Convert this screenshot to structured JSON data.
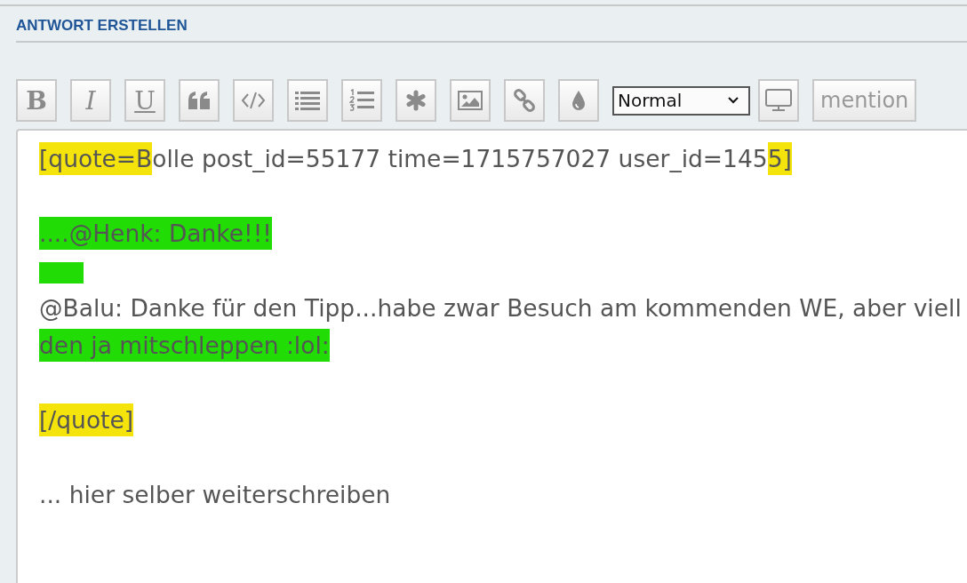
{
  "heading": "ANTWORT ERSTELLEN",
  "toolbar": [
    {
      "kind": "bold",
      "label": "B"
    },
    {
      "kind": "italic",
      "label": "I"
    },
    {
      "kind": "underline",
      "label": "U"
    },
    {
      "kind": "quote"
    },
    {
      "kind": "code"
    },
    {
      "kind": "list"
    },
    {
      "kind": "numbered-list"
    },
    {
      "kind": "asterisk"
    },
    {
      "kind": "image"
    },
    {
      "kind": "link"
    },
    {
      "kind": "drop"
    },
    {
      "kind": "select",
      "value": "Normal"
    },
    {
      "kind": "monitor"
    },
    {
      "kind": "text",
      "label": "mention"
    }
  ],
  "editor_lines": [
    {
      "kind": "text",
      "segments": [
        {
          "text": "[quote=B",
          "color": "#f5e40c"
        },
        {
          "text": "olle post_id=55177 time=1715757027 user_id=145"
        },
        {
          "text": "5]",
          "color": "#f5e40c"
        }
      ]
    },
    {
      "kind": "blank"
    },
    {
      "kind": "text",
      "segments": [
        {
          "text": "....@Henk: Danke!!!",
          "color": "#22dd05"
        }
      ]
    },
    {
      "kind": "mark",
      "color": "#22dd05"
    },
    {
      "kind": "text",
      "segments": [
        {
          "text": "@Balu: Danke für den Tipp...habe zwar Besuch am kommenden WE, aber viell"
        }
      ]
    },
    {
      "kind": "text",
      "segments": [
        {
          "text": "den ja mitschleppen :lol:",
          "color": "#22dd05"
        }
      ]
    },
    {
      "kind": "blank"
    },
    {
      "kind": "text",
      "segments": [
        {
          "text": "[/quote]",
          "color": "#f5e40c"
        }
      ]
    },
    {
      "kind": "blank"
    },
    {
      "kind": "text",
      "segments": [
        {
          "text": "... hier selber weiterschreiben"
        }
      ]
    }
  ]
}
